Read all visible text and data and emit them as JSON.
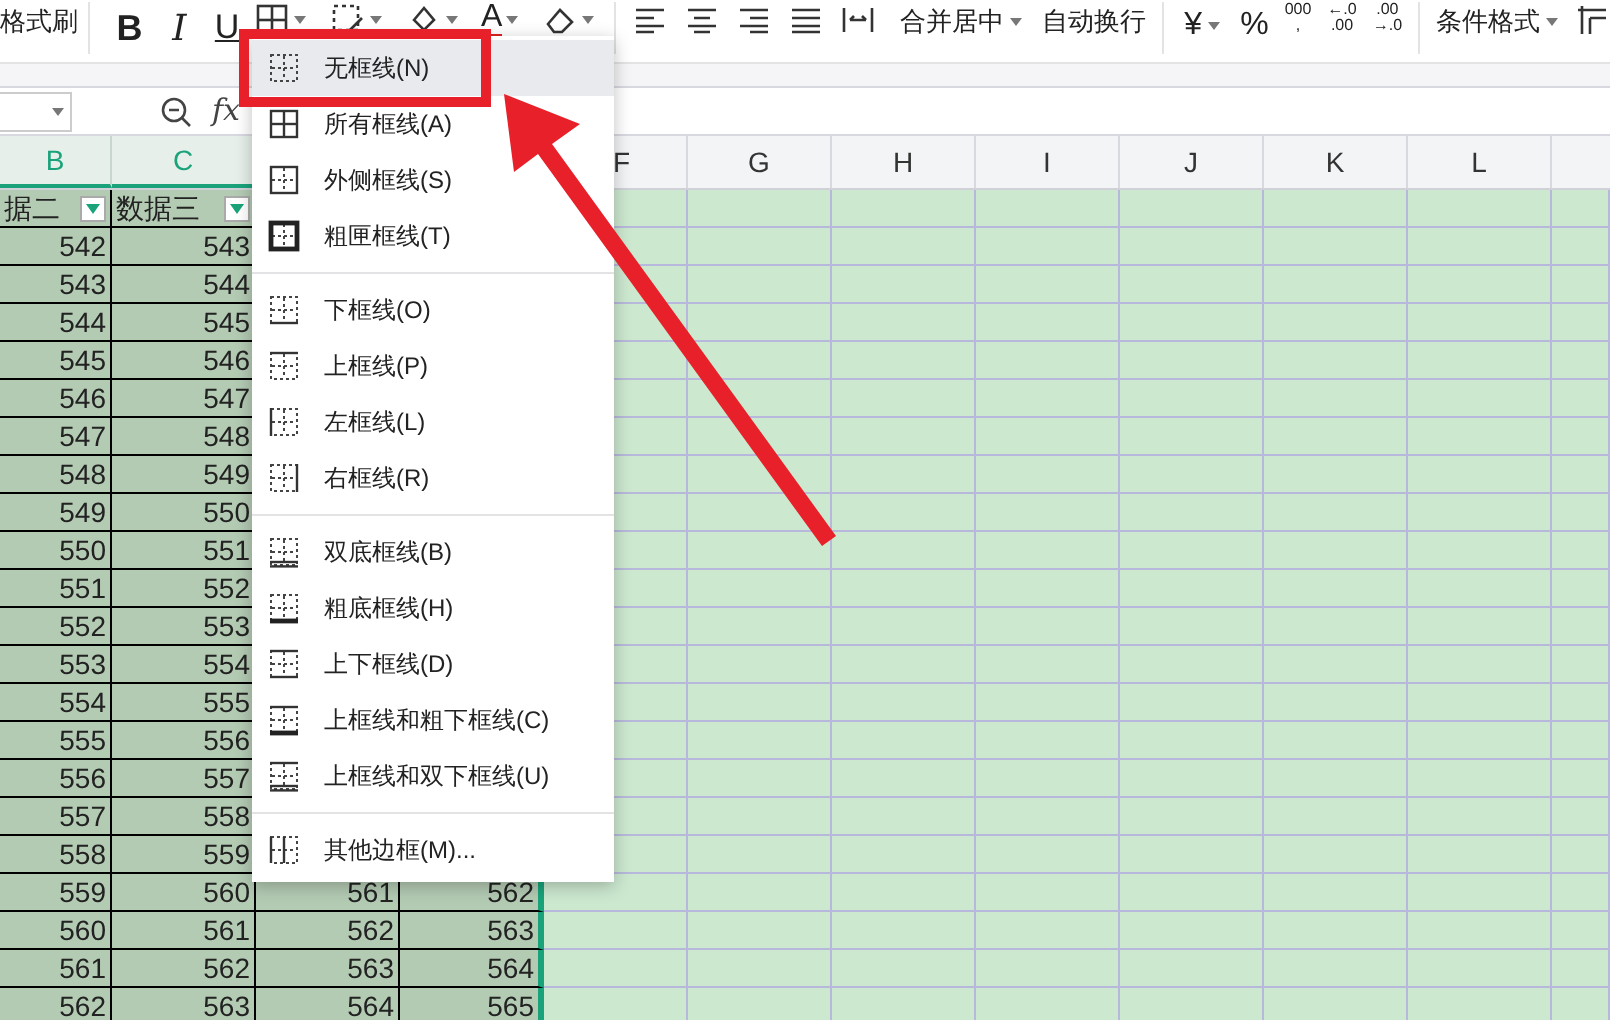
{
  "toolbar": {
    "format_painter": "格式刷",
    "bold": "B",
    "italic": "I",
    "underline": "U",
    "font_color": "A",
    "merge": "合并居中",
    "wrap": "自动换行",
    "currency": "¥",
    "percent": "%",
    "thousands": [
      "000",
      ","
    ],
    "increase_decimal": [
      "←.0",
      ".00"
    ],
    "decrease_decimal": [
      ".00",
      "→.0"
    ],
    "conditional_format": "条件格式"
  },
  "formula_bar": {
    "fx": "fx"
  },
  "columns": [
    {
      "label": "B",
      "selected": true
    },
    {
      "label": "C",
      "selected": true
    },
    {
      "label": "F",
      "selected": false
    },
    {
      "label": "G",
      "selected": false
    },
    {
      "label": "H",
      "selected": false
    },
    {
      "label": "I",
      "selected": false
    },
    {
      "label": "J",
      "selected": false
    },
    {
      "label": "K",
      "selected": false
    },
    {
      "label": "L",
      "selected": false
    }
  ],
  "header_row": [
    "据二",
    "数据三"
  ],
  "rows": [
    [
      "542",
      "543"
    ],
    [
      "543",
      "544"
    ],
    [
      "544",
      "545"
    ],
    [
      "545",
      "546"
    ],
    [
      "546",
      "547"
    ],
    [
      "547",
      "548"
    ],
    [
      "548",
      "549"
    ],
    [
      "549",
      "550"
    ],
    [
      "550",
      "551"
    ],
    [
      "551",
      "552"
    ],
    [
      "552",
      "553"
    ],
    [
      "553",
      "554"
    ],
    [
      "554",
      "555"
    ],
    [
      "555",
      "556"
    ],
    [
      "556",
      "557"
    ],
    [
      "557",
      "558"
    ],
    [
      "558",
      "559"
    ],
    [
      "559",
      "560",
      "561",
      "562"
    ],
    [
      "560",
      "561",
      "562",
      "563"
    ],
    [
      "561",
      "562",
      "563",
      "564"
    ],
    [
      "562",
      "563",
      "564",
      "565"
    ]
  ],
  "border_menu": [
    [
      {
        "label": "无框线(N)",
        "kind": "none",
        "selected": true
      },
      {
        "label": "所有框线(A)",
        "kind": "all",
        "selected": false
      },
      {
        "label": "外侧框线(S)",
        "kind": "outside",
        "selected": false
      },
      {
        "label": "粗匣框线(T)",
        "kind": "thick_box",
        "selected": false
      }
    ],
    [
      {
        "label": "下框线(O)",
        "kind": "bottom",
        "selected": false
      },
      {
        "label": "上框线(P)",
        "kind": "top",
        "selected": false
      },
      {
        "label": "左框线(L)",
        "kind": "left",
        "selected": false
      },
      {
        "label": "右框线(R)",
        "kind": "right",
        "selected": false
      }
    ],
    [
      {
        "label": "双底框线(B)",
        "kind": "double_bottom",
        "selected": false
      },
      {
        "label": "粗底框线(H)",
        "kind": "thick_bottom",
        "selected": false
      },
      {
        "label": "上下框线(D)",
        "kind": "top_bottom",
        "selected": false
      },
      {
        "label": "上框线和粗下框线(C)",
        "kind": "top_thick_bottom",
        "selected": false
      },
      {
        "label": "上框线和双下框线(U)",
        "kind": "top_double_bottom",
        "selected": false
      }
    ],
    [
      {
        "label": "其他边框(M)...",
        "kind": "more",
        "selected": false
      }
    ]
  ]
}
